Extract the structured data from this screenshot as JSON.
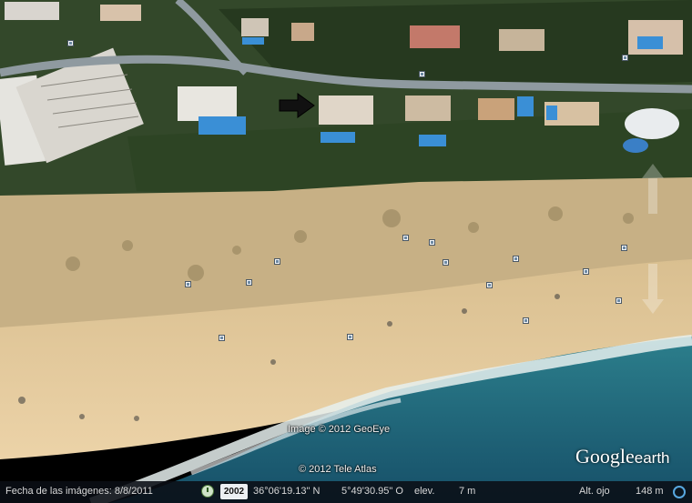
{
  "map": {
    "imagery_credit": "Image © 2012 GeoEye",
    "data_credit": "© 2012 Tele Atlas",
    "logo_main": "Google",
    "logo_sub": "earth",
    "arrow_direction": "right",
    "marker_count": 17,
    "colors": {
      "sea": "#1f6a80",
      "surf": "#e6f0ee",
      "sand": "#e6c79a",
      "dunes": "#c9b388",
      "vegetation": "#2f4a22",
      "road": "#8f9aa0",
      "pool": "#3a8fd6"
    }
  },
  "statusbar": {
    "date_label": "Fecha de las imágenes: 8/8/2011",
    "year": "2002",
    "latitude": "36°06'19.13\" N",
    "longitude": "5°49'30.95\" O",
    "elev_label": "elev.",
    "elev_value": "7 m",
    "eye_label": "Alt. ojo",
    "eye_value": "148 m"
  }
}
